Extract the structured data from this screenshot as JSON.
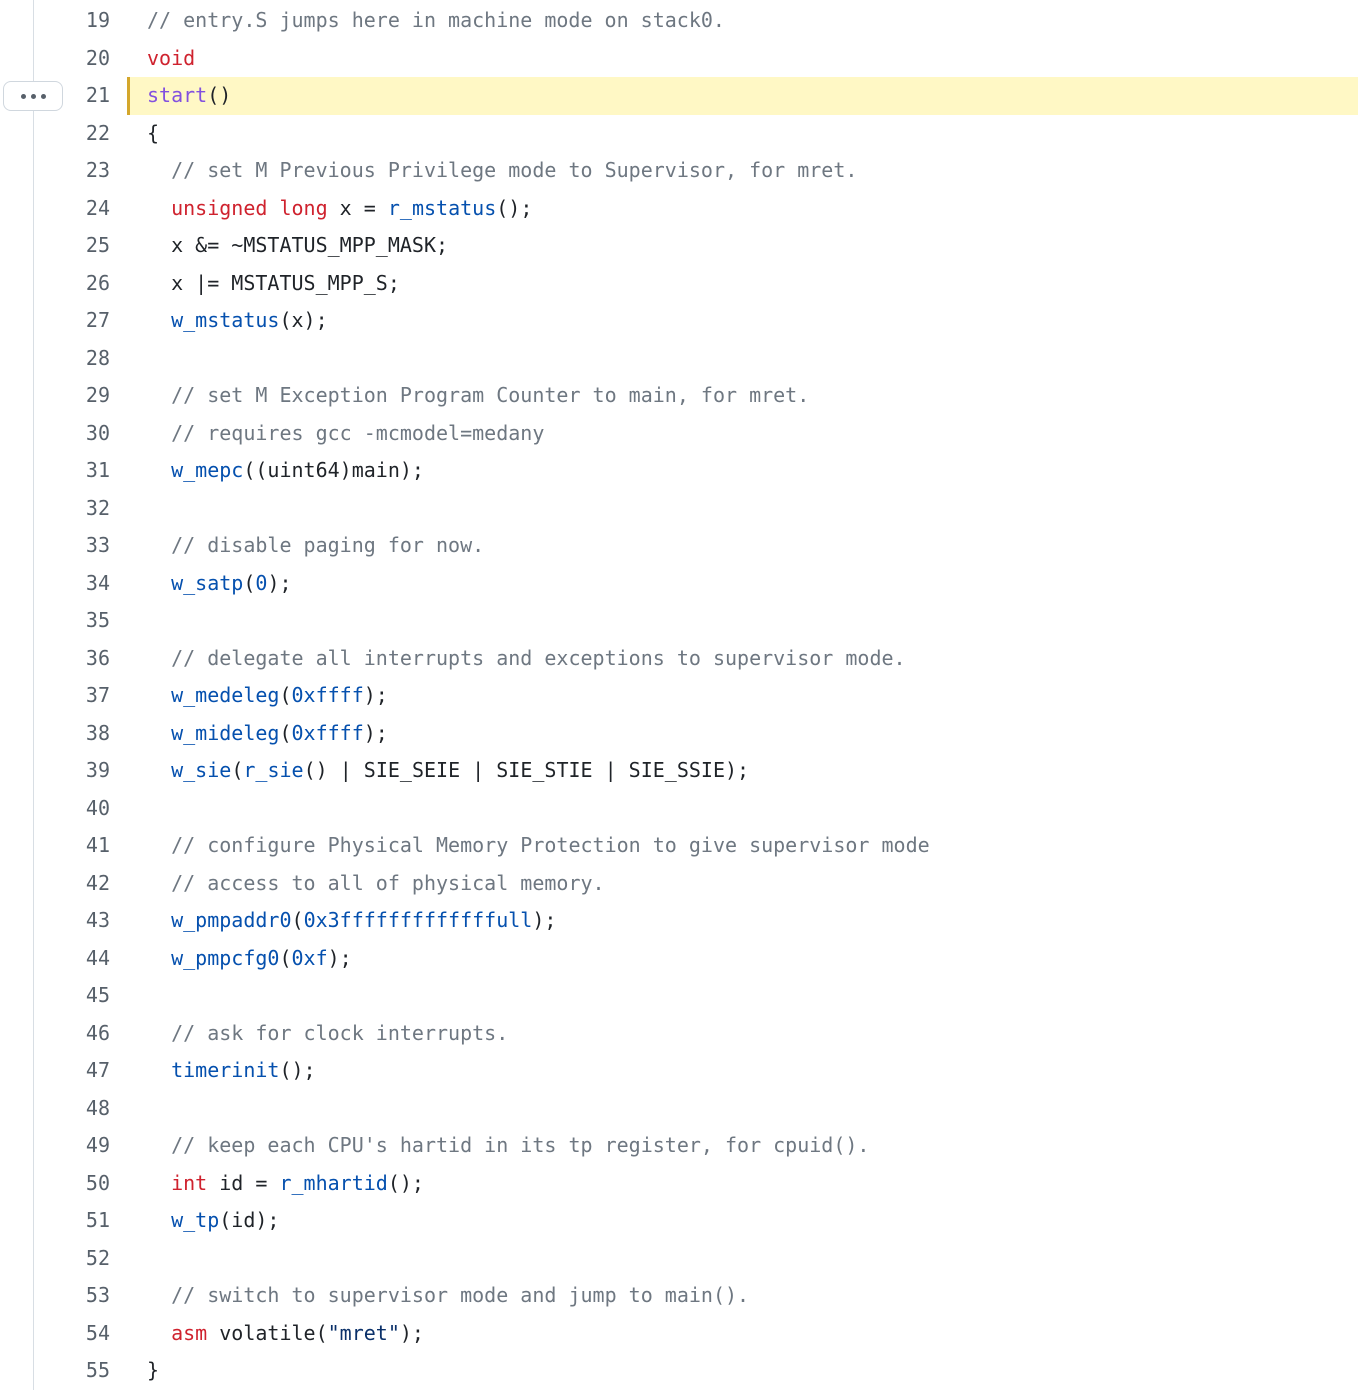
{
  "ui": {
    "expand_button_icon": "kebab-horizontal-icon"
  },
  "lines": [
    {
      "number": "19",
      "tokens": [
        {
          "t": "comment",
          "v": "// entry.S jumps here in machine mode on stack0."
        }
      ]
    },
    {
      "number": "20",
      "tokens": [
        {
          "t": "keyword",
          "v": "void"
        }
      ]
    },
    {
      "number": "21",
      "highlighted": true,
      "tokens": [
        {
          "t": "title",
          "v": "start"
        },
        {
          "t": "plain",
          "v": "()"
        }
      ]
    },
    {
      "number": "22",
      "tokens": [
        {
          "t": "plain",
          "v": "{"
        }
      ]
    },
    {
      "number": "23",
      "tokens": [
        {
          "t": "plain",
          "v": "  "
        },
        {
          "t": "comment",
          "v": "// set M Previous Privilege mode to Supervisor, for mret."
        }
      ]
    },
    {
      "number": "24",
      "tokens": [
        {
          "t": "plain",
          "v": "  "
        },
        {
          "t": "keyword",
          "v": "unsigned"
        },
        {
          "t": "plain",
          "v": " "
        },
        {
          "t": "keyword",
          "v": "long"
        },
        {
          "t": "plain",
          "v": " x = "
        },
        {
          "t": "function",
          "v": "r_mstatus"
        },
        {
          "t": "plain",
          "v": "();"
        }
      ]
    },
    {
      "number": "25",
      "tokens": [
        {
          "t": "plain",
          "v": "  x &= ~MSTATUS_MPP_MASK;"
        }
      ]
    },
    {
      "number": "26",
      "tokens": [
        {
          "t": "plain",
          "v": "  x |= MSTATUS_MPP_S;"
        }
      ]
    },
    {
      "number": "27",
      "tokens": [
        {
          "t": "plain",
          "v": "  "
        },
        {
          "t": "function",
          "v": "w_mstatus"
        },
        {
          "t": "plain",
          "v": "(x);"
        }
      ]
    },
    {
      "number": "28",
      "tokens": []
    },
    {
      "number": "29",
      "tokens": [
        {
          "t": "plain",
          "v": "  "
        },
        {
          "t": "comment",
          "v": "// set M Exception Program Counter to main, for mret."
        }
      ]
    },
    {
      "number": "30",
      "tokens": [
        {
          "t": "plain",
          "v": "  "
        },
        {
          "t": "comment",
          "v": "// requires gcc -mcmodel=medany"
        }
      ]
    },
    {
      "number": "31",
      "tokens": [
        {
          "t": "plain",
          "v": "  "
        },
        {
          "t": "function",
          "v": "w_mepc"
        },
        {
          "t": "plain",
          "v": "((uint64)main);"
        }
      ]
    },
    {
      "number": "32",
      "tokens": []
    },
    {
      "number": "33",
      "tokens": [
        {
          "t": "plain",
          "v": "  "
        },
        {
          "t": "comment",
          "v": "// disable paging for now."
        }
      ]
    },
    {
      "number": "34",
      "tokens": [
        {
          "t": "plain",
          "v": "  "
        },
        {
          "t": "function",
          "v": "w_satp"
        },
        {
          "t": "plain",
          "v": "("
        },
        {
          "t": "number",
          "v": "0"
        },
        {
          "t": "plain",
          "v": ");"
        }
      ]
    },
    {
      "number": "35",
      "tokens": []
    },
    {
      "number": "36",
      "tokens": [
        {
          "t": "plain",
          "v": "  "
        },
        {
          "t": "comment",
          "v": "// delegate all interrupts and exceptions to supervisor mode."
        }
      ]
    },
    {
      "number": "37",
      "tokens": [
        {
          "t": "plain",
          "v": "  "
        },
        {
          "t": "function",
          "v": "w_medeleg"
        },
        {
          "t": "plain",
          "v": "("
        },
        {
          "t": "number",
          "v": "0xffff"
        },
        {
          "t": "plain",
          "v": ");"
        }
      ]
    },
    {
      "number": "38",
      "tokens": [
        {
          "t": "plain",
          "v": "  "
        },
        {
          "t": "function",
          "v": "w_mideleg"
        },
        {
          "t": "plain",
          "v": "("
        },
        {
          "t": "number",
          "v": "0xffff"
        },
        {
          "t": "plain",
          "v": ");"
        }
      ]
    },
    {
      "number": "39",
      "tokens": [
        {
          "t": "plain",
          "v": "  "
        },
        {
          "t": "function",
          "v": "w_sie"
        },
        {
          "t": "plain",
          "v": "("
        },
        {
          "t": "function",
          "v": "r_sie"
        },
        {
          "t": "plain",
          "v": "() | SIE_SEIE | SIE_STIE | SIE_SSIE);"
        }
      ]
    },
    {
      "number": "40",
      "tokens": []
    },
    {
      "number": "41",
      "tokens": [
        {
          "t": "plain",
          "v": "  "
        },
        {
          "t": "comment",
          "v": "// configure Physical Memory Protection to give supervisor mode"
        }
      ]
    },
    {
      "number": "42",
      "tokens": [
        {
          "t": "plain",
          "v": "  "
        },
        {
          "t": "comment",
          "v": "// access to all of physical memory."
        }
      ]
    },
    {
      "number": "43",
      "tokens": [
        {
          "t": "plain",
          "v": "  "
        },
        {
          "t": "function",
          "v": "w_pmpaddr0"
        },
        {
          "t": "plain",
          "v": "("
        },
        {
          "t": "number",
          "v": "0x3fffffffffffffull"
        },
        {
          "t": "plain",
          "v": ");"
        }
      ]
    },
    {
      "number": "44",
      "tokens": [
        {
          "t": "plain",
          "v": "  "
        },
        {
          "t": "function",
          "v": "w_pmpcfg0"
        },
        {
          "t": "plain",
          "v": "("
        },
        {
          "t": "number",
          "v": "0xf"
        },
        {
          "t": "plain",
          "v": ");"
        }
      ]
    },
    {
      "number": "45",
      "tokens": []
    },
    {
      "number": "46",
      "tokens": [
        {
          "t": "plain",
          "v": "  "
        },
        {
          "t": "comment",
          "v": "// ask for clock interrupts."
        }
      ]
    },
    {
      "number": "47",
      "tokens": [
        {
          "t": "plain",
          "v": "  "
        },
        {
          "t": "function",
          "v": "timerinit"
        },
        {
          "t": "plain",
          "v": "();"
        }
      ]
    },
    {
      "number": "48",
      "tokens": []
    },
    {
      "number": "49",
      "tokens": [
        {
          "t": "plain",
          "v": "  "
        },
        {
          "t": "comment",
          "v": "// keep each CPU's hartid in its tp register, for cpuid()."
        }
      ]
    },
    {
      "number": "50",
      "tokens": [
        {
          "t": "plain",
          "v": "  "
        },
        {
          "t": "keyword",
          "v": "int"
        },
        {
          "t": "plain",
          "v": " id = "
        },
        {
          "t": "function",
          "v": "r_mhartid"
        },
        {
          "t": "plain",
          "v": "();"
        }
      ]
    },
    {
      "number": "51",
      "tokens": [
        {
          "t": "plain",
          "v": "  "
        },
        {
          "t": "function",
          "v": "w_tp"
        },
        {
          "t": "plain",
          "v": "(id);"
        }
      ]
    },
    {
      "number": "52",
      "tokens": []
    },
    {
      "number": "53",
      "tokens": [
        {
          "t": "plain",
          "v": "  "
        },
        {
          "t": "comment",
          "v": "// switch to supervisor mode and jump to main()."
        }
      ]
    },
    {
      "number": "54",
      "tokens": [
        {
          "t": "plain",
          "v": "  "
        },
        {
          "t": "keyword",
          "v": "asm"
        },
        {
          "t": "plain",
          "v": " volatile("
        },
        {
          "t": "string",
          "v": "\"mret\""
        },
        {
          "t": "plain",
          "v": ");"
        }
      ]
    },
    {
      "number": "55",
      "tokens": [
        {
          "t": "plain",
          "v": "}"
        }
      ]
    }
  ]
}
